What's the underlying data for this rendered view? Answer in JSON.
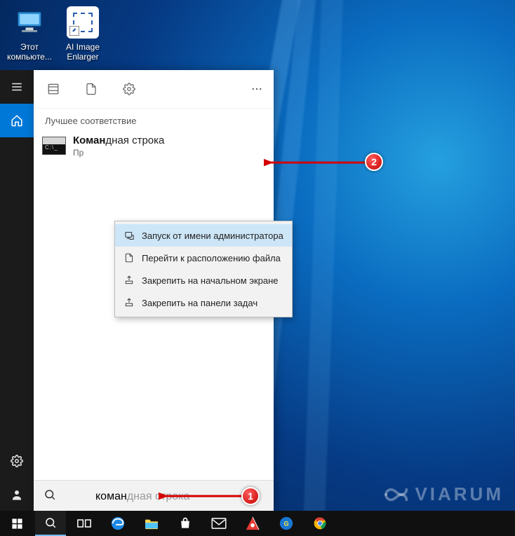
{
  "desktop_icons": [
    {
      "label": "Этот компьюте..."
    },
    {
      "label": "AI Image Enlarger"
    }
  ],
  "sidebar": {
    "hamburger": "menu-icon",
    "home": "home-icon",
    "settings": "settings-icon",
    "user": "user-icon"
  },
  "panel": {
    "best_match_header": "Лучшее соответствие",
    "result_title_hl": "Коман",
    "result_title_rest": "дная строка",
    "result_subtitle_prefix": "Пр"
  },
  "context_menu": [
    "Запуск от имени администратора",
    "Перейти к расположению файла",
    "Закрепить на начальном экране",
    "Закрепить на панели задач"
  ],
  "search": {
    "typed": "коман",
    "suggestion_rest": "дная строка",
    "placeholder": ""
  },
  "annotations": {
    "badge1": "1",
    "badge2": "2"
  },
  "watermark": "VIARUM",
  "colors": {
    "accent": "#0078d7",
    "badge": "#c40000"
  }
}
